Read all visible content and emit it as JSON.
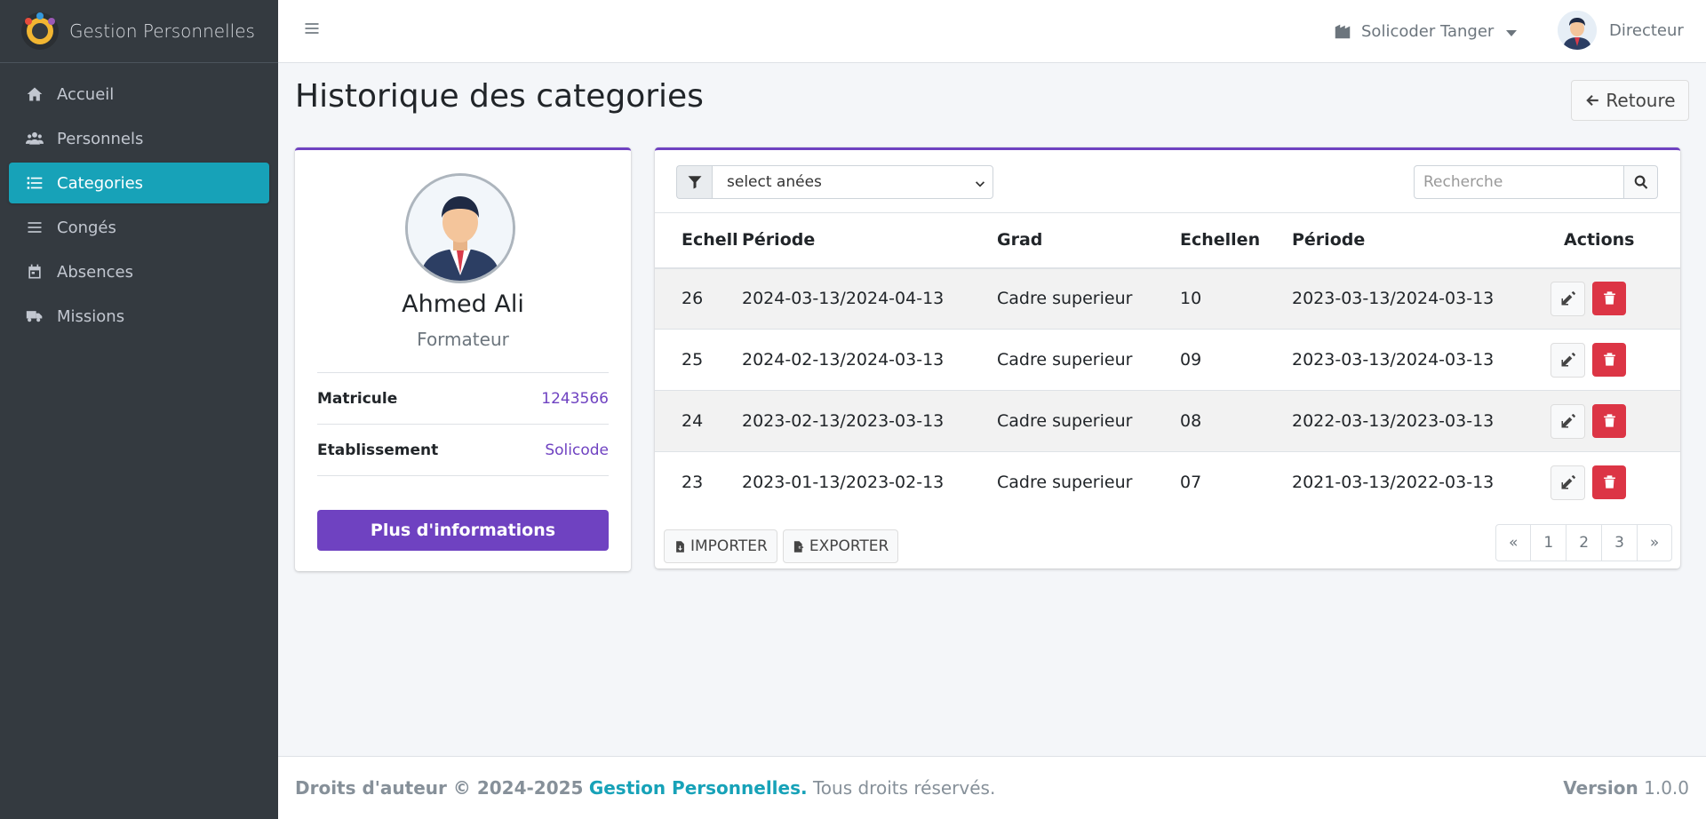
{
  "brand": {
    "title": "Gestion Personnelles"
  },
  "sidebar": {
    "items": [
      {
        "label": "Accueil",
        "icon": "home-icon"
      },
      {
        "label": "Personnels",
        "icon": "users-icon"
      },
      {
        "label": "Categories",
        "icon": "list-icon",
        "active": true
      },
      {
        "label": "Congés",
        "icon": "bars-icon"
      },
      {
        "label": "Absences",
        "icon": "calendar-icon"
      },
      {
        "label": "Missions",
        "icon": "truck-icon"
      }
    ]
  },
  "header": {
    "org_label": "Solicoder Tanger",
    "user_label": "Directeur"
  },
  "page": {
    "title": "Historique des categories",
    "back_label": "Retoure"
  },
  "profile": {
    "name": "Ahmed Ali",
    "role": "Formateur",
    "fields": [
      {
        "key": "Matricule",
        "value": "1243566"
      },
      {
        "key": "Etablissement",
        "value": "Solicode"
      }
    ],
    "more_label": "Plus d'informations"
  },
  "table": {
    "filter_placeholder": "select anées",
    "search_placeholder": "Recherche",
    "headers": [
      "Echell",
      "Période",
      "Grad",
      "Echellen",
      "Période",
      "Actions"
    ],
    "rows": [
      [
        "26",
        "2024-03-13/2024-04-13",
        "Cadre superieur",
        "10",
        "2023-03-13/2024-03-13"
      ],
      [
        "25",
        "2024-02-13/2024-03-13",
        "Cadre superieur",
        "09",
        "2023-03-13/2024-03-13"
      ],
      [
        "24",
        "2023-02-13/2023-03-13",
        "Cadre superieur",
        "08",
        "2022-03-13/2023-03-13"
      ],
      [
        "23",
        "2023-01-13/2023-02-13",
        "Cadre superieur",
        "07",
        "2021-03-13/2022-03-13"
      ]
    ],
    "import_label": "IMPORTER",
    "export_label": "EXPORTER",
    "pages": [
      "«",
      "1",
      "2",
      "3",
      "»"
    ]
  },
  "footer": {
    "copyright": "Droits d'auteur © 2024-2025",
    "brand": "Gestion Personnelles.",
    "rights": "Tous droits réservés.",
    "version_label": "Version",
    "version_value": "1.0.0"
  },
  "colors": {
    "sidebar_bg": "#343a40",
    "active": "#17a2b8",
    "accent": "#6f42c1",
    "danger": "#dc3545"
  }
}
